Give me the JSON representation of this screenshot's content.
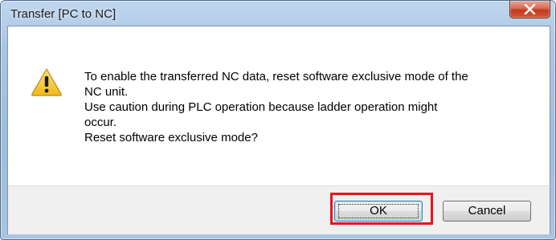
{
  "window": {
    "title": "Transfer [PC to NC]"
  },
  "icon": {
    "name": "warning-icon",
    "color": "#f6c72c"
  },
  "message": {
    "lines": [
      "To enable the transferred NC data, reset software exclusive mode of the",
      "NC unit.",
      "Use caution during PLC operation because ladder operation might",
      "occur.",
      "Reset software exclusive mode?"
    ]
  },
  "buttons": {
    "ok": "OK",
    "cancel": "Cancel"
  },
  "highlight": {
    "target": "ok-button",
    "color": "#e8141e"
  }
}
